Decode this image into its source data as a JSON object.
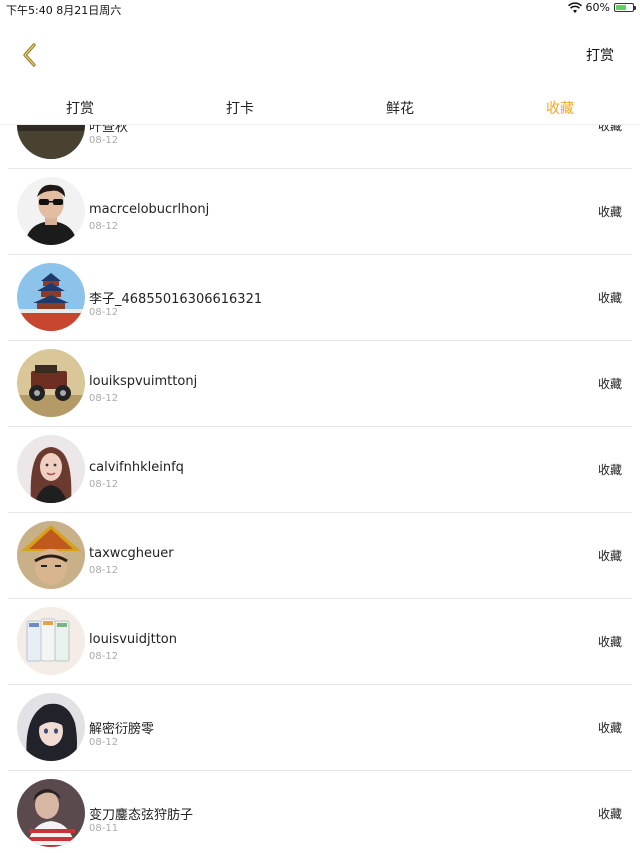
{
  "status": {
    "time_date": "下午5:40   8月21日周六",
    "battery_percent": "60%",
    "battery_level": 0.6,
    "wifi_icon": "wifi-icon",
    "charging_icon": "battery-charging-icon"
  },
  "nav": {
    "back_icon": "chevron-left-icon",
    "right_label": "打赏",
    "accent": "#f0a82a"
  },
  "tabs": [
    {
      "label": "打赏",
      "active": false
    },
    {
      "label": "打卡",
      "active": false
    },
    {
      "label": "鲜花",
      "active": false
    },
    {
      "label": "收藏",
      "active": true
    }
  ],
  "rows": [
    {
      "name": "叶查秋",
      "date": "08-12",
      "action": "收藏",
      "avatar": "text-image-avatar"
    },
    {
      "name": "macrcelobucrlhonj",
      "date": "08-12",
      "action": "收藏",
      "avatar": "man-sunglasses-avatar"
    },
    {
      "name": "李子_46855016306616321",
      "date": "08-12",
      "action": "收藏",
      "avatar": "temple-of-heaven-avatar"
    },
    {
      "name": "louikspvuimttonj",
      "date": "08-12",
      "action": "收藏",
      "avatar": "vintage-car-avatar"
    },
    {
      "name": "calvifnhkleinfq",
      "date": "08-12",
      "action": "收藏",
      "avatar": "woman-portrait-avatar"
    },
    {
      "name": "taxwcgheuer",
      "date": "08-12",
      "action": "收藏",
      "avatar": "anime-hat-avatar"
    },
    {
      "name": "louisvuidjtton",
      "date": "08-12",
      "action": "收藏",
      "avatar": "cards-avatar"
    },
    {
      "name": "解密衍膀零",
      "date": "08-12",
      "action": "收藏",
      "avatar": "anime-girl-avatar"
    },
    {
      "name": "变刀鏖态弦狩肪子",
      "date": "08-11",
      "action": "收藏",
      "avatar": "striped-shirt-avatar"
    }
  ]
}
